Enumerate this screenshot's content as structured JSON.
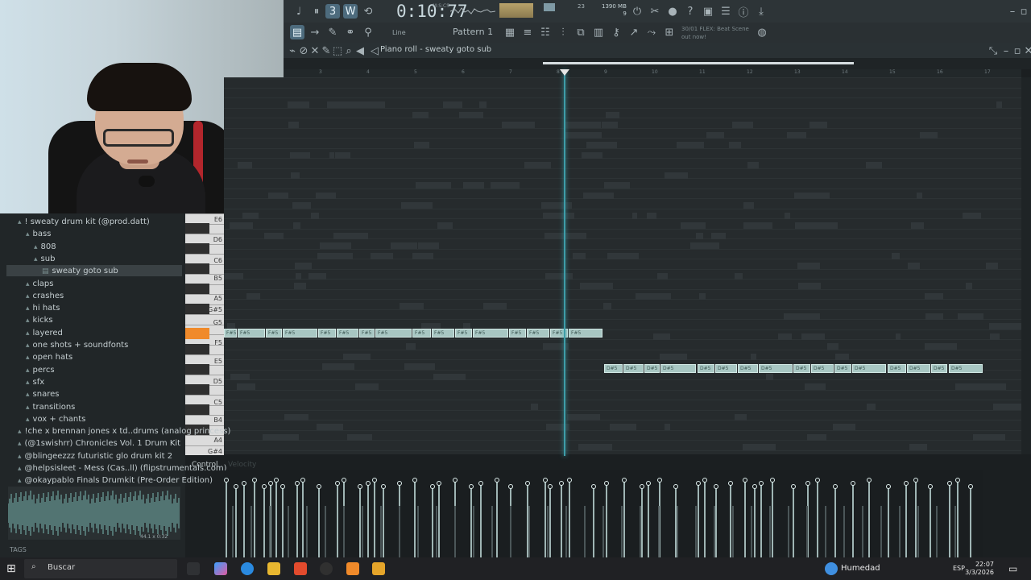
{
  "toolbar": {
    "time": "0:10:77",
    "time_unit": "M:S:CS",
    "line_mode": "Line",
    "pattern": "Pattern 1",
    "cpu_polyphony": "23",
    "cpu_polyphony2": "9",
    "memory": "1390 MB",
    "news": [
      "30/01 FLEX: Beat Scene",
      "out now!"
    ]
  },
  "piano_roll": {
    "title": "Piano roll - sweaty goto sub",
    "ruler": [
      "3",
      "4",
      "5",
      "6",
      "7",
      "8",
      "9",
      "10",
      "11",
      "12",
      "13",
      "14",
      "15",
      "16",
      "17"
    ],
    "note_label_top": "F#5",
    "note_label_bottom": "D#5",
    "control_label": "Control",
    "velocity_label": "Velocity"
  },
  "keys": {
    "labels": [
      "E6",
      "D6",
      "C6",
      "B5",
      "A5",
      "G#5",
      "G5",
      "F5",
      "E5",
      "D5",
      "C5",
      "B4",
      "A4",
      "G#4"
    ]
  },
  "browser": {
    "items": [
      {
        "label": "! sweaty drum kit (@prod.datt)",
        "indent": 0
      },
      {
        "label": "bass",
        "indent": 1
      },
      {
        "label": "808",
        "indent": 2
      },
      {
        "label": "sub",
        "indent": 2
      },
      {
        "label": "sweaty goto sub",
        "indent": 3
      },
      {
        "label": "claps",
        "indent": 1
      },
      {
        "label": "crashes",
        "indent": 1
      },
      {
        "label": "hi hats",
        "indent": 1
      },
      {
        "label": "kicks",
        "indent": 1
      },
      {
        "label": "layered",
        "indent": 1
      },
      {
        "label": "one shots + soundfonts",
        "indent": 1
      },
      {
        "label": "open hats",
        "indent": 1
      },
      {
        "label": "percs",
        "indent": 1
      },
      {
        "label": "sfx",
        "indent": 1
      },
      {
        "label": "snares",
        "indent": 1
      },
      {
        "label": "transitions",
        "indent": 1
      },
      {
        "label": "vox + chants",
        "indent": 1
      },
      {
        "label": "!che x brennan jones x td..drums (analog princess)",
        "indent": 0
      },
      {
        "label": "(@1swishrr) Chronicles Vol. 1 Drum Kit",
        "indent": 0
      },
      {
        "label": "@blingeezzz futuristic glo drum kit 2",
        "indent": 0
      },
      {
        "label": "@helpsisleet - Mess (Cas..ll) (flipstrumentals.com)",
        "indent": 0
      },
      {
        "label": "@okaypablo Finals Drumkit (Pre-Order Edition)",
        "indent": 0
      }
    ],
    "wave_info": "44.1 x 0:32",
    "tags": "TAGS"
  },
  "taskbar": {
    "search": "Buscar",
    "weather": "Humedad",
    "lang": "ESP",
    "time": "22:07",
    "date": "3/3/2026"
  },
  "colors": {
    "note": "#a8c7c3",
    "accent": "#3e9da8",
    "active_key": "#f08a2a"
  }
}
